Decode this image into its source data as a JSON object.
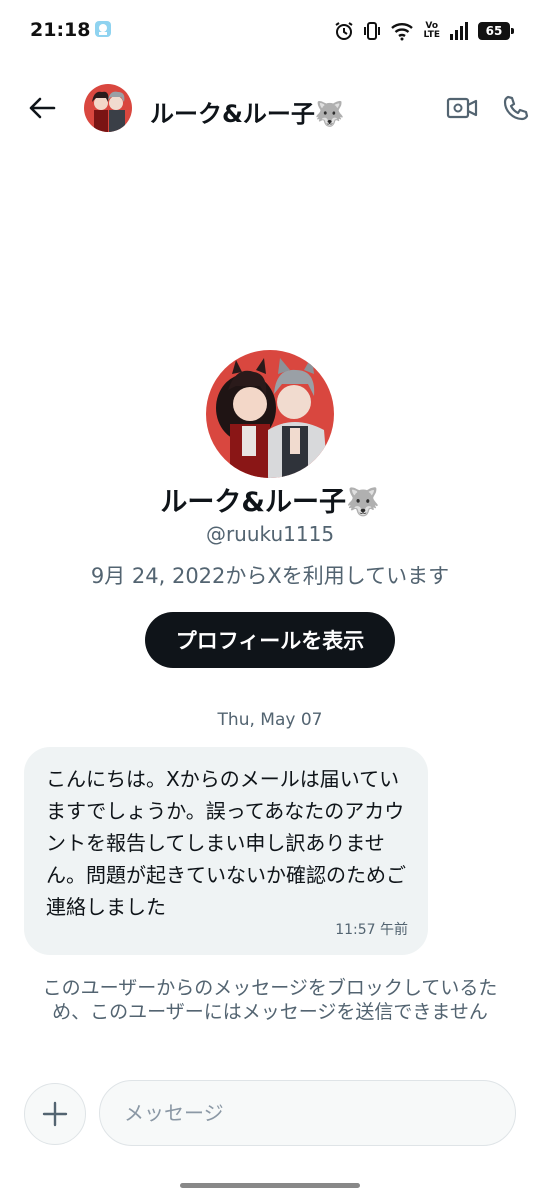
{
  "status_bar": {
    "time": "21:18",
    "battery": "65",
    "network_label": "Vo\nLTE"
  },
  "header": {
    "contact_name": "ルーク&ルー子🐺"
  },
  "profile": {
    "name": "ルーク&ルー子🐺",
    "handle": "@ruuku1115",
    "joined": "9月 24, 2022からXを利用しています",
    "view_profile_label": "プロフィールを表示"
  },
  "conversation": {
    "date_divider": "Thu, May 07",
    "messages": [
      {
        "text": "こんにちは。Xからのメールは届いていますでしょうか。誤ってあなたのアカウントを報告してしまい申し訳ありません。問題が起きていないか確認のためご連絡しました",
        "time": "11:57 午前"
      }
    ]
  },
  "blocked_notice": "このユーザーからのメッセージをブロックしているため、このユーザーにはメッセージを送信できません",
  "composer": {
    "placeholder": "メッセージ"
  },
  "colors": {
    "primary_text": "#0f1419",
    "secondary_text": "#536471",
    "bubble_bg": "#eff3f4",
    "button_bg": "#0f1419",
    "avatar_bg": "#d9473f"
  }
}
